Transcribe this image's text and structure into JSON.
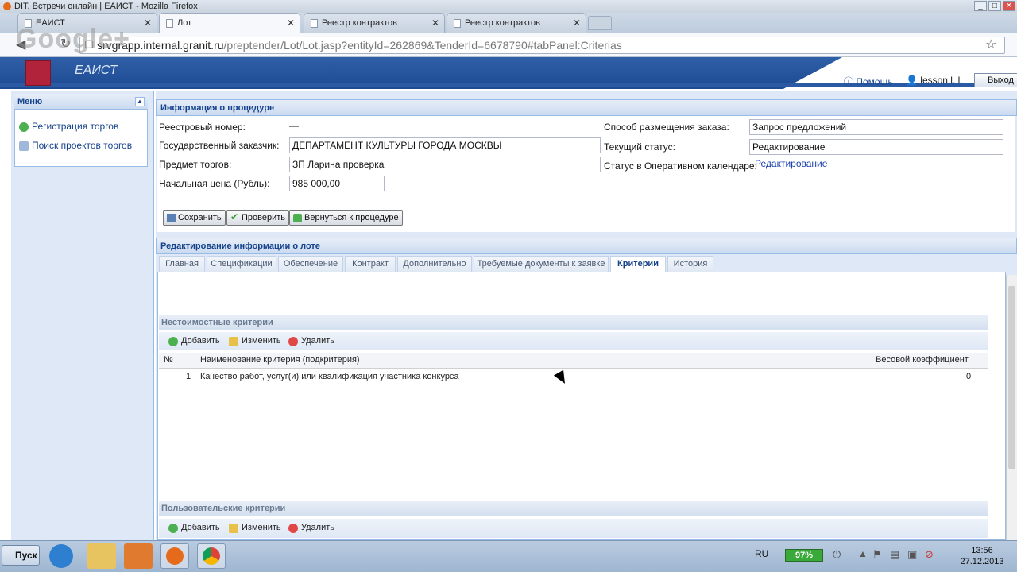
{
  "window": {
    "title": "DIT. Встречи онлайн | ЕАИСТ - Mozilla Firefox",
    "controls": [
      "_",
      "□",
      "✕"
    ]
  },
  "browser_tabs": [
    {
      "label": "ЕАИСТ",
      "active": false
    },
    {
      "label": "Лот",
      "active": true
    },
    {
      "label": "Реестр контрактов",
      "active": false
    },
    {
      "label": "Реестр контрактов",
      "active": false
    }
  ],
  "address": {
    "host": "srvgrapp.internal.granit.ru",
    "path": "/preptender/Lot/Lot.jasp?entityId=262869&TenderId=6678790#tabPanel:Criterias",
    "watermark": "Google+"
  },
  "app": {
    "name": "ЕАИСТ",
    "help": "Помощь",
    "user": "lesson l. l.",
    "exit": "Выход"
  },
  "menu": {
    "title": "Меню",
    "collapse_glyph": "▲",
    "items": [
      "Регистрация торгов",
      "Поиск проектов торгов"
    ]
  },
  "procedure": {
    "title": "Информация о процедуре",
    "registry_number_label": "Реестровый номер:",
    "registry_number_value": "—",
    "customer_label": "Государственный заказчик:",
    "customer_value": "ДЕПАРТАМЕНТ КУЛЬТУРЫ ГОРОДА МОСКВЫ",
    "subject_label": "Предмет торгов:",
    "subject_value": "ЗП Ларина проверка",
    "price_label": "Начальная цена (Рубль):",
    "price_value": "985 000,00",
    "method_label": "Способ размещения заказа:",
    "method_value": "Запрос предложений",
    "status_label": "Текущий статус:",
    "status_value": "Редактирование",
    "calendar_label": "Статус в Оперативном календаре:",
    "calendar_value": "Редактирование",
    "buttons": {
      "save": "Сохранить",
      "check": "Проверить",
      "back": "Вернуться к процедуре"
    }
  },
  "lot": {
    "title": "Редактирование информации о лоте",
    "tabs": [
      "Главная",
      "Спецификации",
      "Обеспечение",
      "Контракт",
      "Дополнительно",
      "Требуемые документы к заявке",
      "Критерии",
      "История"
    ],
    "active_tab": "Критерии"
  },
  "nonvalue_criteria": {
    "title": "Нестоимостные критерии",
    "toolbar": {
      "add": "Добавить",
      "edit": "Изменить",
      "delete": "Удалить"
    },
    "columns": {
      "num": "№",
      "name": "Наименование критерия (подкритерия)",
      "weight": "Весовой коэффициент"
    },
    "rows": [
      {
        "num": "1",
        "name": "Качество работ, услуг(и) или квалификация участника конкурса",
        "weight": "0"
      }
    ]
  },
  "custom_criteria": {
    "title": "Пользовательские критерии",
    "toolbar": {
      "add": "Добавить",
      "edit": "Изменить",
      "delete": "Удалить"
    }
  },
  "taskbar": {
    "start": "Пуск",
    "lang": "RU",
    "battery": "97%",
    "time": "13:56",
    "date": "27.12.2013"
  },
  "colors": {
    "accent": "#15428b",
    "header_blue": "#2b5aa4",
    "link": "#1a3fb0"
  }
}
